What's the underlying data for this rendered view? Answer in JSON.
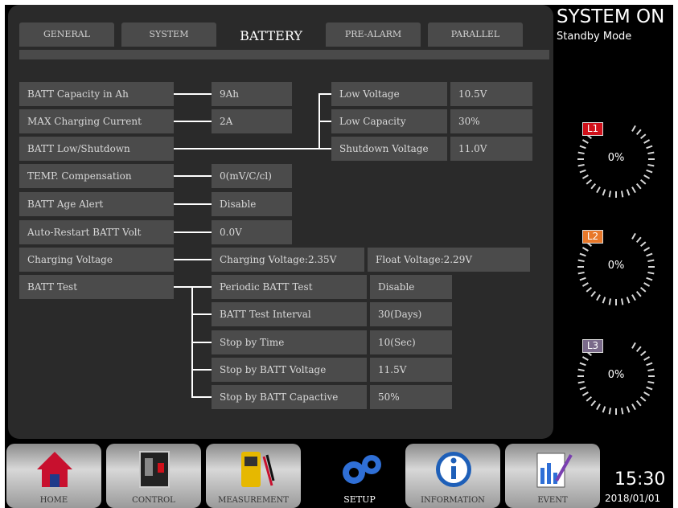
{
  "tabs": [
    "GENERAL",
    "SYSTEM",
    "BATTERY",
    "PRE-ALARM",
    "PARALLEL"
  ],
  "active_tab": "BATTERY",
  "settings": {
    "capacity": {
      "label": "BATT Capacity in Ah",
      "value": "9Ah"
    },
    "max_charging": {
      "label": "MAX Charging Current",
      "value": "2A"
    },
    "low_shutdown": {
      "label": "BATT Low/Shutdown"
    },
    "low_voltage": {
      "label": "Low Voltage",
      "value": "10.5V"
    },
    "low_capacity": {
      "label": "Low Capacity",
      "value": "30%"
    },
    "shutdown_voltage": {
      "label": "Shutdown Voltage",
      "value": "11.0V"
    },
    "temp_comp": {
      "label": "TEMP. Compensation",
      "value": "0(mV/C/cl)"
    },
    "age_alert": {
      "label": "BATT Age Alert",
      "value": "Disable"
    },
    "auto_restart": {
      "label": "Auto-Restart BATT Volt",
      "value": "0.0V"
    },
    "charging_voltage": {
      "label": "Charging Voltage",
      "value1": "Charging Voltage:2.35V",
      "value2": "Float Voltage:2.29V"
    },
    "batt_test": {
      "label": "BATT Test"
    },
    "periodic": {
      "label": "Periodic BATT Test",
      "value": "Disable"
    },
    "interval": {
      "label": "BATT Test Interval",
      "value": "30(Days)"
    },
    "stop_time": {
      "label": "Stop by Time",
      "value": "10(Sec)"
    },
    "stop_voltage": {
      "label": "Stop by BATT Voltage",
      "value": "11.5V"
    },
    "stop_capacity": {
      "label": "Stop by BATT Capactive",
      "value": "50%"
    }
  },
  "status": {
    "title": "SYSTEM ON",
    "mode": "Standby Mode"
  },
  "gauges": [
    {
      "phase": "L1",
      "value": "0%",
      "level": 0,
      "color": "#d0101a"
    },
    {
      "phase": "L2",
      "value": "0%",
      "level": 0,
      "color": "#e8782a"
    },
    {
      "phase": "L3",
      "value": "0%",
      "level": 0,
      "color": "#7a6a8a"
    }
  ],
  "nav": [
    "HOME",
    "CONTROL",
    "MEASUREMENT",
    "SETUP",
    "INFORMATION",
    "EVENT"
  ],
  "time": "15:30",
  "date": "2018/01/01"
}
